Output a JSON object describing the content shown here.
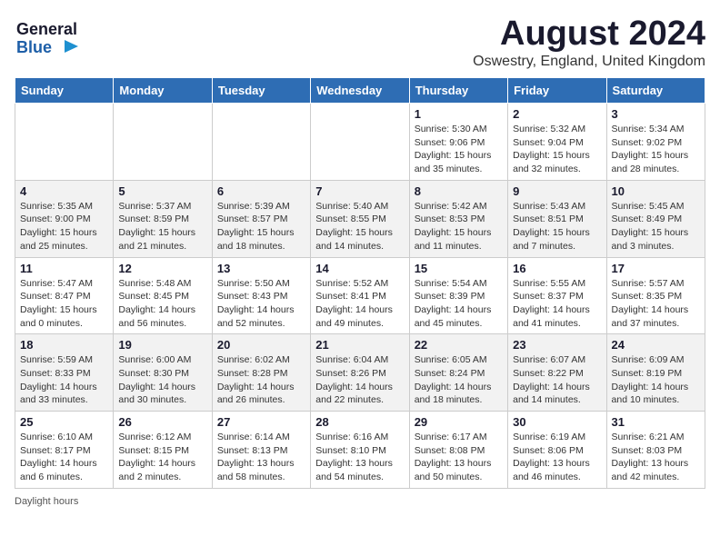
{
  "header": {
    "logo_line1": "General",
    "logo_line2": "Blue",
    "main_title": "August 2024",
    "subtitle": "Oswestry, England, United Kingdom"
  },
  "calendar": {
    "days_of_week": [
      "Sunday",
      "Monday",
      "Tuesday",
      "Wednesday",
      "Thursday",
      "Friday",
      "Saturday"
    ],
    "weeks": [
      [
        {
          "day": "",
          "detail": ""
        },
        {
          "day": "",
          "detail": ""
        },
        {
          "day": "",
          "detail": ""
        },
        {
          "day": "",
          "detail": ""
        },
        {
          "day": "1",
          "detail": "Sunrise: 5:30 AM\nSunset: 9:06 PM\nDaylight: 15 hours\nand 35 minutes."
        },
        {
          "day": "2",
          "detail": "Sunrise: 5:32 AM\nSunset: 9:04 PM\nDaylight: 15 hours\nand 32 minutes."
        },
        {
          "day": "3",
          "detail": "Sunrise: 5:34 AM\nSunset: 9:02 PM\nDaylight: 15 hours\nand 28 minutes."
        }
      ],
      [
        {
          "day": "4",
          "detail": "Sunrise: 5:35 AM\nSunset: 9:00 PM\nDaylight: 15 hours\nand 25 minutes."
        },
        {
          "day": "5",
          "detail": "Sunrise: 5:37 AM\nSunset: 8:59 PM\nDaylight: 15 hours\nand 21 minutes."
        },
        {
          "day": "6",
          "detail": "Sunrise: 5:39 AM\nSunset: 8:57 PM\nDaylight: 15 hours\nand 18 minutes."
        },
        {
          "day": "7",
          "detail": "Sunrise: 5:40 AM\nSunset: 8:55 PM\nDaylight: 15 hours\nand 14 minutes."
        },
        {
          "day": "8",
          "detail": "Sunrise: 5:42 AM\nSunset: 8:53 PM\nDaylight: 15 hours\nand 11 minutes."
        },
        {
          "day": "9",
          "detail": "Sunrise: 5:43 AM\nSunset: 8:51 PM\nDaylight: 15 hours\nand 7 minutes."
        },
        {
          "day": "10",
          "detail": "Sunrise: 5:45 AM\nSunset: 8:49 PM\nDaylight: 15 hours\nand 3 minutes."
        }
      ],
      [
        {
          "day": "11",
          "detail": "Sunrise: 5:47 AM\nSunset: 8:47 PM\nDaylight: 15 hours\nand 0 minutes."
        },
        {
          "day": "12",
          "detail": "Sunrise: 5:48 AM\nSunset: 8:45 PM\nDaylight: 14 hours\nand 56 minutes."
        },
        {
          "day": "13",
          "detail": "Sunrise: 5:50 AM\nSunset: 8:43 PM\nDaylight: 14 hours\nand 52 minutes."
        },
        {
          "day": "14",
          "detail": "Sunrise: 5:52 AM\nSunset: 8:41 PM\nDaylight: 14 hours\nand 49 minutes."
        },
        {
          "day": "15",
          "detail": "Sunrise: 5:54 AM\nSunset: 8:39 PM\nDaylight: 14 hours\nand 45 minutes."
        },
        {
          "day": "16",
          "detail": "Sunrise: 5:55 AM\nSunset: 8:37 PM\nDaylight: 14 hours\nand 41 minutes."
        },
        {
          "day": "17",
          "detail": "Sunrise: 5:57 AM\nSunset: 8:35 PM\nDaylight: 14 hours\nand 37 minutes."
        }
      ],
      [
        {
          "day": "18",
          "detail": "Sunrise: 5:59 AM\nSunset: 8:33 PM\nDaylight: 14 hours\nand 33 minutes."
        },
        {
          "day": "19",
          "detail": "Sunrise: 6:00 AM\nSunset: 8:30 PM\nDaylight: 14 hours\nand 30 minutes."
        },
        {
          "day": "20",
          "detail": "Sunrise: 6:02 AM\nSunset: 8:28 PM\nDaylight: 14 hours\nand 26 minutes."
        },
        {
          "day": "21",
          "detail": "Sunrise: 6:04 AM\nSunset: 8:26 PM\nDaylight: 14 hours\nand 22 minutes."
        },
        {
          "day": "22",
          "detail": "Sunrise: 6:05 AM\nSunset: 8:24 PM\nDaylight: 14 hours\nand 18 minutes."
        },
        {
          "day": "23",
          "detail": "Sunrise: 6:07 AM\nSunset: 8:22 PM\nDaylight: 14 hours\nand 14 minutes."
        },
        {
          "day": "24",
          "detail": "Sunrise: 6:09 AM\nSunset: 8:19 PM\nDaylight: 14 hours\nand 10 minutes."
        }
      ],
      [
        {
          "day": "25",
          "detail": "Sunrise: 6:10 AM\nSunset: 8:17 PM\nDaylight: 14 hours\nand 6 minutes."
        },
        {
          "day": "26",
          "detail": "Sunrise: 6:12 AM\nSunset: 8:15 PM\nDaylight: 14 hours\nand 2 minutes."
        },
        {
          "day": "27",
          "detail": "Sunrise: 6:14 AM\nSunset: 8:13 PM\nDaylight: 13 hours\nand 58 minutes."
        },
        {
          "day": "28",
          "detail": "Sunrise: 6:16 AM\nSunset: 8:10 PM\nDaylight: 13 hours\nand 54 minutes."
        },
        {
          "day": "29",
          "detail": "Sunrise: 6:17 AM\nSunset: 8:08 PM\nDaylight: 13 hours\nand 50 minutes."
        },
        {
          "day": "30",
          "detail": "Sunrise: 6:19 AM\nSunset: 8:06 PM\nDaylight: 13 hours\nand 46 minutes."
        },
        {
          "day": "31",
          "detail": "Sunrise: 6:21 AM\nSunset: 8:03 PM\nDaylight: 13 hours\nand 42 minutes."
        }
      ]
    ]
  },
  "footer": {
    "text": "Daylight hours"
  }
}
